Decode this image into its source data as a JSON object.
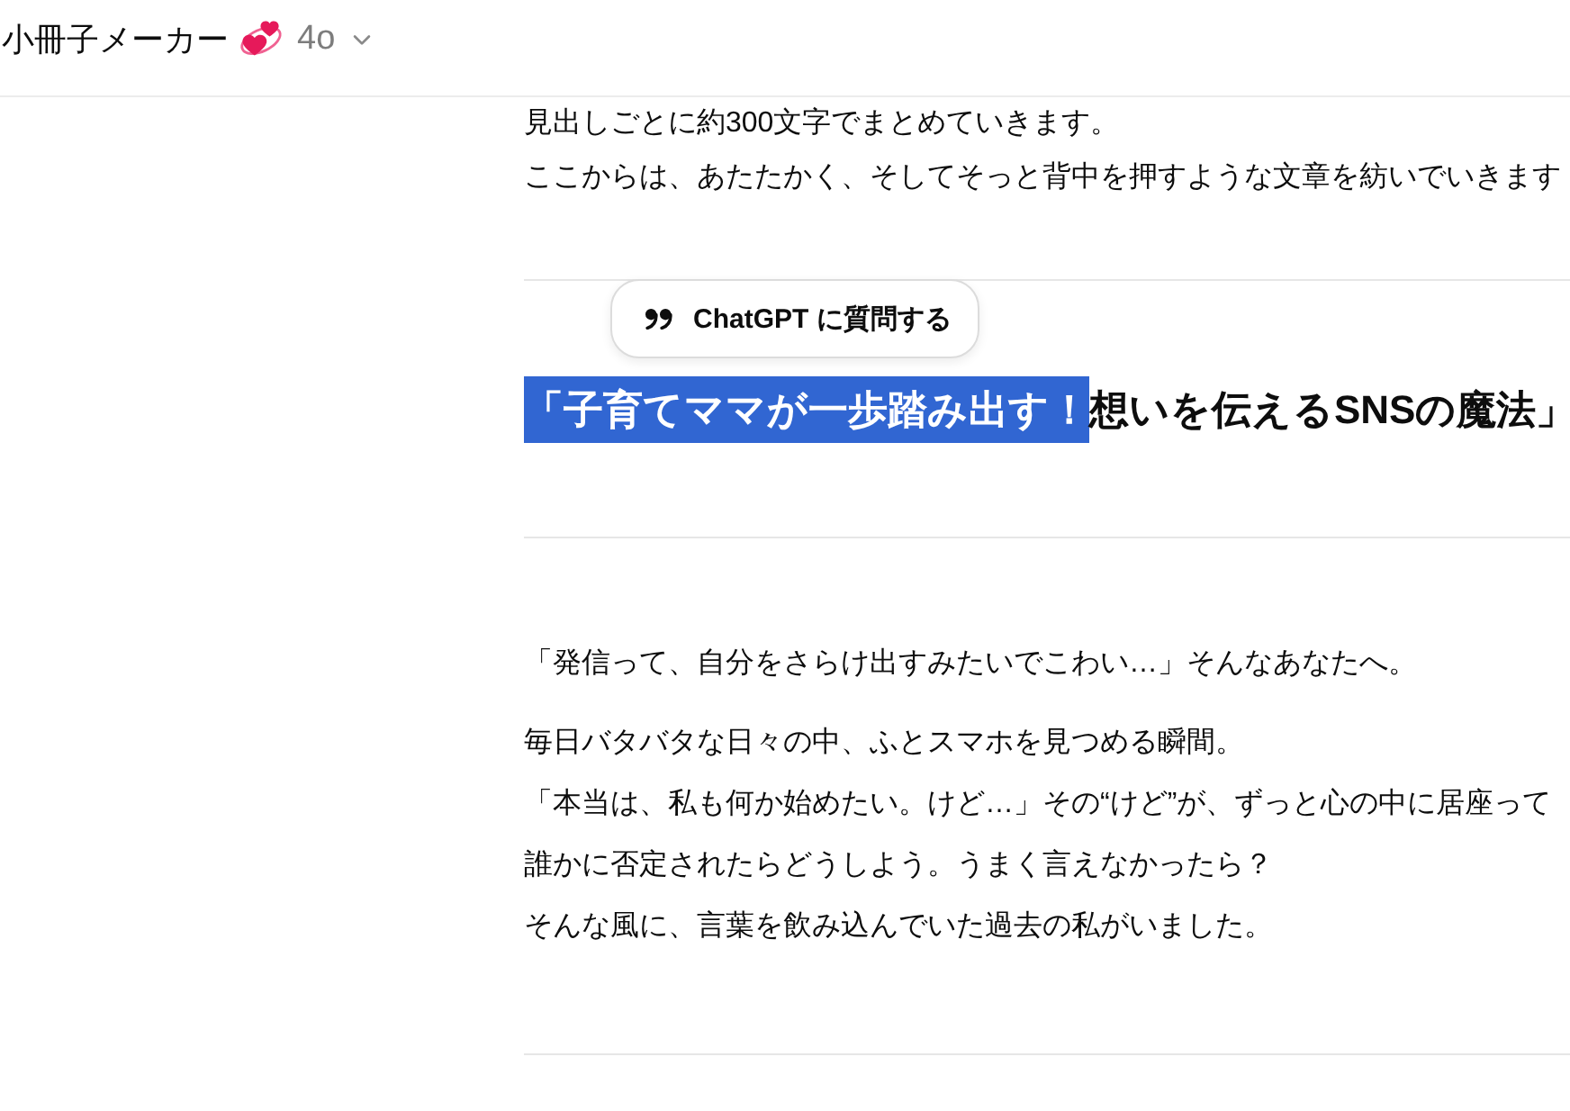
{
  "header": {
    "title": "小冊子メーカー",
    "model": "4o"
  },
  "intro": {
    "lines": [
      "見出しごとに約300文字でまとめていきます。",
      "ここからは、あたたかく、そしてそっと背中を押すような文章を紡いでいきます"
    ]
  },
  "ask_popup": {
    "label": "ChatGPT に質問する"
  },
  "heading": {
    "segments": [
      {
        "text": "「子育てママが一歩踏み出す！",
        "selected": true
      },
      {
        "text": "想いを伝えるSNSの魔法」",
        "selected": false
      }
    ]
  },
  "paragraphs": [
    {
      "lines": [
        "「発信って、自分をさらけ出すみたいでこわい…」そんなあなたへ。"
      ]
    },
    {
      "lines": [
        "毎日バタバタな日々の中、ふとスマホを見つめる瞬間。",
        "「本当は、私も何か始めたい。けど…」その“けど”が、ずっと心の中に居座って",
        "誰かに否定されたらどうしよう。うまく言えなかったら？",
        "そんな風に、言葉を飲み込んでいた過去の私がいました。"
      ]
    }
  ]
}
